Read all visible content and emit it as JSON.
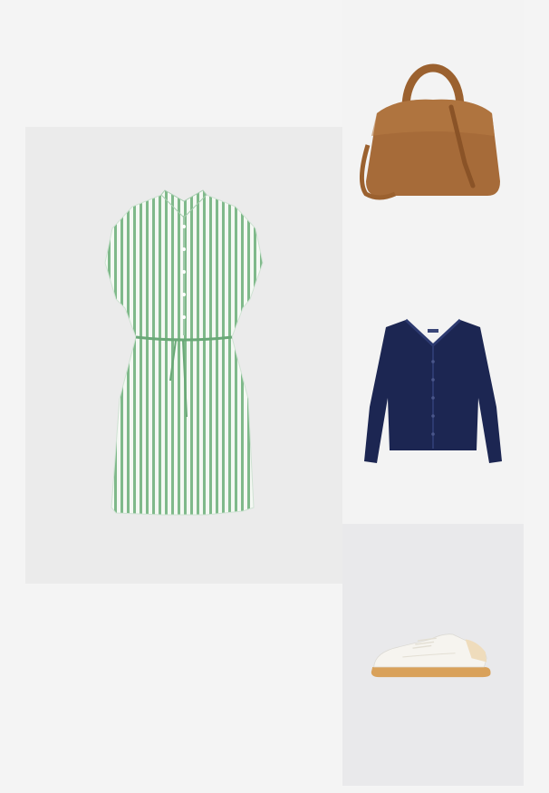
{
  "outfit": {
    "items": [
      {
        "name": "striped-shirt-dress",
        "icon": "green-white-striped-dress",
        "color": "#7fb98a"
      },
      {
        "name": "suede-handbag",
        "icon": "tan-suede-tote-bag",
        "color": "#a4693a"
      },
      {
        "name": "v-neck-cardigan",
        "icon": "navy-knit-cardigan",
        "color": "#1c2652"
      },
      {
        "name": "gum-sole-sneaker",
        "icon": "white-leather-sneaker",
        "color": "#d9a15a"
      }
    ],
    "colors": {
      "page_background": "#f4f4f4",
      "dress_tile": "#ebebeb",
      "bag_tile": "#f3f3f3",
      "cardigan_tile": "#f3f3f3",
      "sneaker_tile": "#e9e9eb"
    }
  }
}
